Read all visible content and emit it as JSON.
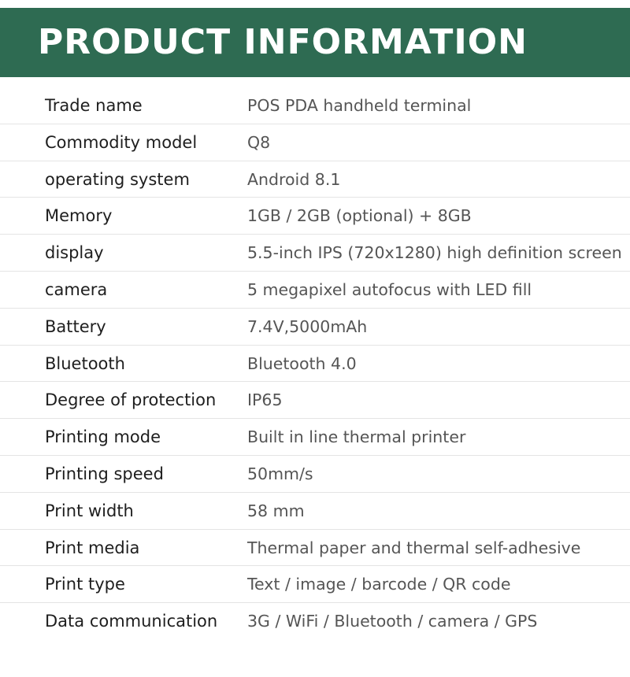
{
  "header": {
    "title": "PRODUCT INFORMATION"
  },
  "colors": {
    "header_bg": "#2e6b52",
    "header_text": "#ffffff",
    "label_text": "#1e1e1e",
    "value_text": "#555555",
    "divider": "#e4e4e4"
  },
  "specs": [
    {
      "name": "Trade name",
      "value": "POS PDA handheld terminal"
    },
    {
      "name": "Commodity model",
      "value": "Q8"
    },
    {
      "name": "operating system",
      "value": "Android 8.1"
    },
    {
      "name": "Memory",
      "value": "1GB / 2GB (optional) + 8GB"
    },
    {
      "name": "display",
      "value": "5.5-inch IPS (720x1280) high definition screen"
    },
    {
      "name": "camera",
      "value": "5 megapixel autofocus with LED fill"
    },
    {
      "name": "Battery",
      "value": "7.4V,5000mAh"
    },
    {
      "name": "Bluetooth",
      "value": "Bluetooth 4.0"
    },
    {
      "name": "Degree of protection",
      "value": "IP65"
    },
    {
      "name": "Printing mode",
      "value": "Built in line thermal printer"
    },
    {
      "name": "Printing speed",
      "value": "50mm/s"
    },
    {
      "name": "Print width",
      "value": "58 mm"
    },
    {
      "name": "Print media",
      "value": "Thermal paper and thermal self-adhesive"
    },
    {
      "name": "Print type",
      "value": "Text / image / barcode / QR code"
    },
    {
      "name": "Data communication",
      "value": "3G / WiFi / Bluetooth / camera / GPS"
    }
  ]
}
